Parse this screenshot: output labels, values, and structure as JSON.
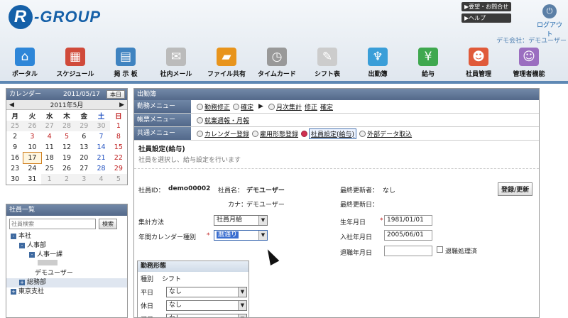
{
  "app": {
    "logo": "R-GROUP",
    "logo_r": "R",
    "logo_rest": "-GROUP"
  },
  "top": {
    "btn1": "▶要望・お問合せ",
    "btn2": "▶ヘルプ",
    "logout": "ログアウト",
    "user": "デモ会社：デモユーザー"
  },
  "nav": [
    {
      "label": "ポータル",
      "color": "#2e86d8",
      "glyph": "⌂"
    },
    {
      "label": "スケジュール",
      "color": "#d04a3a",
      "glyph": "▦"
    },
    {
      "label": "掲 示 板",
      "color": "#3f83c0",
      "glyph": "▤"
    },
    {
      "label": "社内メール",
      "color": "#bbbbbb",
      "glyph": "✉"
    },
    {
      "label": "ファイル共有",
      "color": "#e8941c",
      "glyph": "▰"
    },
    {
      "label": "タイムカード",
      "color": "#999999",
      "glyph": "◷"
    },
    {
      "label": "シフト表",
      "color": "#cccccc",
      "glyph": "✎"
    },
    {
      "label": "出勤簿",
      "color": "#3a9ed8",
      "glyph": "♆"
    },
    {
      "label": "給与",
      "color": "#3fa84f",
      "glyph": "¥"
    },
    {
      "label": "社員管理",
      "color": "#e05a3a",
      "glyph": "☻"
    },
    {
      "label": "管理者機能",
      "color": "#9b6ec0",
      "glyph": "☺"
    }
  ],
  "calendar": {
    "title": "カレンダー",
    "date": "2011/05/17",
    "today_btn": "本日",
    "month": "2011年5月",
    "prev": "◀",
    "next": "▶",
    "weekdays": [
      "月",
      "火",
      "水",
      "木",
      "金",
      "土",
      "日"
    ],
    "weeks": [
      [
        "25",
        "26",
        "27",
        "28",
        "29",
        "30",
        "1"
      ],
      [
        "2",
        "3",
        "4",
        "5",
        "6",
        "7",
        "8"
      ],
      [
        "9",
        "10",
        "11",
        "12",
        "13",
        "14",
        "15"
      ],
      [
        "16",
        "17",
        "18",
        "19",
        "20",
        "21",
        "22"
      ],
      [
        "23",
        "24",
        "25",
        "26",
        "27",
        "28",
        "29"
      ],
      [
        "30",
        "31",
        "1",
        "2",
        "3",
        "4",
        "5"
      ]
    ]
  },
  "employees": {
    "title": "社員一覧",
    "search_placeholder": "社員検索",
    "search_btn": "検索",
    "tree": [
      "本社",
      "人事部",
      "人事一課",
      "デモユーザー",
      "総務部",
      "東京支社"
    ]
  },
  "main": {
    "title": "出勤簿",
    "menus": [
      {
        "label": "勤務メニュー",
        "items": [
          "勤務修正",
          "確定",
          "月次集計",
          "修正",
          "確定"
        ]
      },
      {
        "label": "帳票メニュー",
        "items": [
          "就業週報・月報"
        ]
      },
      {
        "label": "共通メニュー",
        "items": [
          "カレンダー登録",
          "雇用形態登録",
          "社員設定(給与)",
          "外部データ取込"
        ]
      }
    ],
    "section_title": "社員設定(給与)",
    "section_desc": "社員を選択し、給与設定を行います",
    "emp_id_label": "社員ID：",
    "emp_id": "demo00002",
    "emp_name_label": "社員名：",
    "emp_name": "デモユーザー",
    "kana_label": "カナ：",
    "kana": "デモユーザー",
    "updater_label": "最終更新者：",
    "updater": "なし",
    "updated_label": "最終更新日：",
    "save_btn": "登録/更新",
    "calc_label": "集計方法",
    "calc_value": "社員月給",
    "yearcal_label": "年間カレンダー種別",
    "yearcal_value": "暦通り",
    "birth_label": "生年月日",
    "birth_value": "1981/01/01",
    "join_label": "入社年月日",
    "join_value": "2005/06/01",
    "leave_label": "退職年月日",
    "retire_check": "退職処理済",
    "work_title": "勤務形態",
    "col_type": "種別",
    "col_shift": "シフト",
    "rows": [
      {
        "type": "平日",
        "value": "なし"
      },
      {
        "type": "休日",
        "value": "なし"
      },
      {
        "type": "祝日",
        "value": "なし"
      }
    ],
    "req_mark": "*",
    "arrow_glyph": "▼",
    "play_glyph": "▶"
  }
}
